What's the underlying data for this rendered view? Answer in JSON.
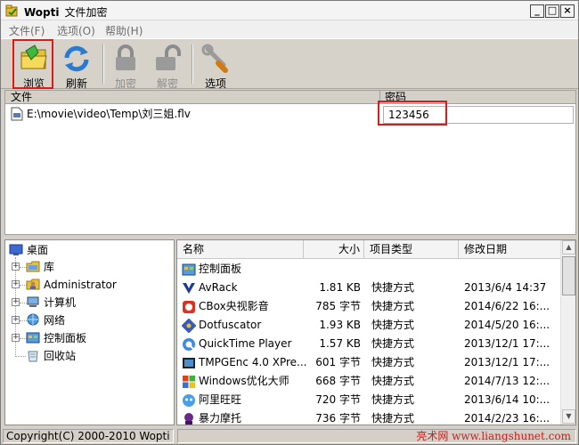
{
  "window": {
    "app_name": "Wopti",
    "title": "文件加密",
    "minimize": "_",
    "maximize": "□",
    "close": "×"
  },
  "menu": [
    {
      "label": "文件(F)"
    },
    {
      "label": "选项(O)"
    },
    {
      "label": "帮助(H)"
    }
  ],
  "toolbar": {
    "browse": "浏览",
    "refresh": "刷新",
    "encrypt": "加密",
    "decrypt": "解密",
    "options": "选项"
  },
  "file_table": {
    "col_file": "文件",
    "col_password": "密码",
    "row": {
      "path": "E:\\movie\\video\\Temp\\刘三姐.flv",
      "password": "123456"
    }
  },
  "tree": [
    {
      "label": "桌面",
      "icon": "desktop-icon"
    },
    {
      "label": "库",
      "icon": "folder-icon"
    },
    {
      "label": "Administrator",
      "icon": "user-folder-icon"
    },
    {
      "label": "计算机",
      "icon": "computer-icon"
    },
    {
      "label": "网络",
      "icon": "network-icon"
    },
    {
      "label": "控制面板",
      "icon": "control-panel-icon"
    },
    {
      "label": "回收站",
      "icon": "recycle-bin-icon"
    }
  ],
  "list": {
    "headers": {
      "name": "名称",
      "size": "大小",
      "type": "项目类型",
      "date": "修改日期"
    },
    "rows": [
      {
        "name": "控制面板",
        "size": "",
        "type": "",
        "date": ""
      },
      {
        "name": "AvRack",
        "size": "1.81 KB",
        "type": "快捷方式",
        "date": "2013/6/4 14:37"
      },
      {
        "name": "CBox央视影音",
        "size": "785 字节",
        "type": "快捷方式",
        "date": "2014/6/22 16:..."
      },
      {
        "name": "Dotfuscator",
        "size": "1.93 KB",
        "type": "快捷方式",
        "date": "2014/5/20 16:..."
      },
      {
        "name": "QuickTime Player",
        "size": "1.57 KB",
        "type": "快捷方式",
        "date": "2013/12/1 17:..."
      },
      {
        "name": "TMPGEnc 4.0 XPre...",
        "size": "601 字节",
        "type": "快捷方式",
        "date": "2013/12/1 17:..."
      },
      {
        "name": "Windows优化大师",
        "size": "668 字节",
        "type": "快捷方式",
        "date": "2014/7/13 12:..."
      },
      {
        "name": "阿里旺旺",
        "size": "720 字节",
        "type": "快捷方式",
        "date": "2013/6/14 10:..."
      },
      {
        "name": "暴力摩托",
        "size": "736 字节",
        "type": "快捷方式",
        "date": "2014/2/23 16:..."
      }
    ]
  },
  "status": {
    "copyright": "Copyright(C) 2000-2010 Wopti",
    "watermark": "亮术网 www.liangshunet.com"
  },
  "colors": {
    "highlight": "#e01818"
  }
}
